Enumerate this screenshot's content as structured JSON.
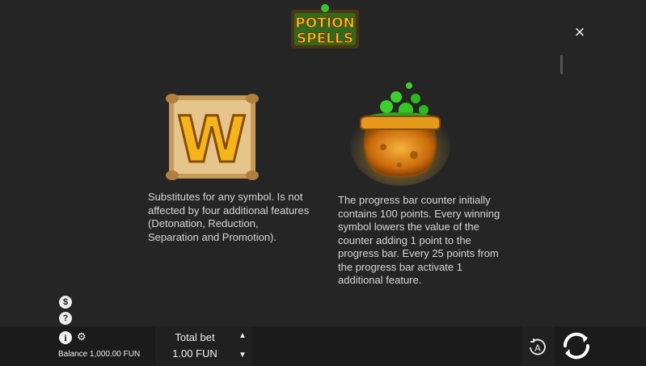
{
  "logo": {
    "line1": "POTION",
    "line2": "SPELLS"
  },
  "close": {
    "glyph": "×"
  },
  "symbols": {
    "wild": {
      "letter": "W",
      "description": "Substitutes for any symbol. Is not affected by four additional features (Detonation, Reduction, Separation and Promotion)."
    },
    "cauldron": {
      "description": "The progress bar counter initially contains 100 points. Every winning symbol lowers the value of the counter adding 1 point to the progress bar. Every 25 points from the progress bar activate 1 additional feature."
    }
  },
  "side_icons": {
    "currency": "$",
    "help": "?"
  },
  "bottom": {
    "info": "i",
    "gear": "⚙",
    "balance": "Balance 1,000.00 FUN",
    "total_bet_label": "Total bet",
    "total_bet_value": "1.00 FUN",
    "up_arrow": "▲",
    "down_arrow": "▼",
    "auto_label": "A"
  },
  "colors": {
    "background": "#252525",
    "bar": "#1b1b1b",
    "gold": "#f2b318",
    "green": "#3cd12a"
  }
}
